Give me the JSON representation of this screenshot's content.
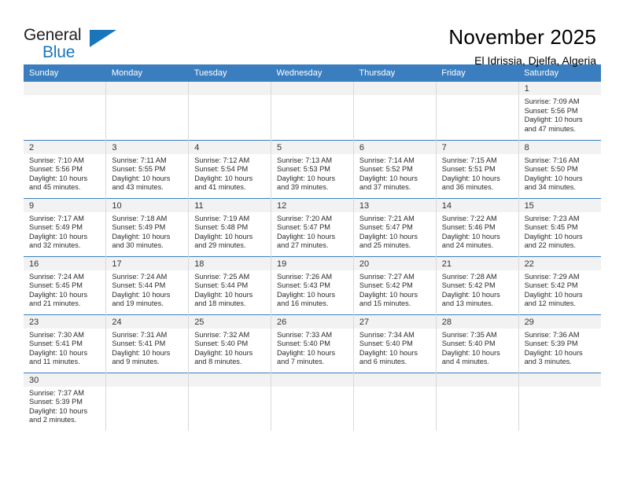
{
  "brand": {
    "line1": "General",
    "line2": "Blue",
    "triangle_color": "#1b75bb"
  },
  "header": {
    "title": "November 2025",
    "subtitle": "El Idrissia, Djelfa, Algeria"
  },
  "theme": {
    "header_blue": "#3a7ebf",
    "daynum_band": "#f2f2f2",
    "text": "#000000"
  },
  "calendar": {
    "weekday_headers": [
      "Sunday",
      "Monday",
      "Tuesday",
      "Wednesday",
      "Thursday",
      "Friday",
      "Saturday"
    ],
    "labels": {
      "sunrise": "Sunrise:",
      "sunset": "Sunset:",
      "daylight": "Daylight:"
    },
    "weeks": [
      [
        {
          "day": "",
          "blank": true
        },
        {
          "day": "",
          "blank": true
        },
        {
          "day": "",
          "blank": true
        },
        {
          "day": "",
          "blank": true
        },
        {
          "day": "",
          "blank": true
        },
        {
          "day": "",
          "blank": true
        },
        {
          "day": "1",
          "sunrise": "Sunrise: 7:09 AM",
          "sunset": "Sunset: 5:56 PM",
          "daylight": "Daylight: 10 hours and 47 minutes."
        }
      ],
      [
        {
          "day": "2",
          "sunrise": "Sunrise: 7:10 AM",
          "sunset": "Sunset: 5:56 PM",
          "daylight": "Daylight: 10 hours and 45 minutes."
        },
        {
          "day": "3",
          "sunrise": "Sunrise: 7:11 AM",
          "sunset": "Sunset: 5:55 PM",
          "daylight": "Daylight: 10 hours and 43 minutes."
        },
        {
          "day": "4",
          "sunrise": "Sunrise: 7:12 AM",
          "sunset": "Sunset: 5:54 PM",
          "daylight": "Daylight: 10 hours and 41 minutes."
        },
        {
          "day": "5",
          "sunrise": "Sunrise: 7:13 AM",
          "sunset": "Sunset: 5:53 PM",
          "daylight": "Daylight: 10 hours and 39 minutes."
        },
        {
          "day": "6",
          "sunrise": "Sunrise: 7:14 AM",
          "sunset": "Sunset: 5:52 PM",
          "daylight": "Daylight: 10 hours and 37 minutes."
        },
        {
          "day": "7",
          "sunrise": "Sunrise: 7:15 AM",
          "sunset": "Sunset: 5:51 PM",
          "daylight": "Daylight: 10 hours and 36 minutes."
        },
        {
          "day": "8",
          "sunrise": "Sunrise: 7:16 AM",
          "sunset": "Sunset: 5:50 PM",
          "daylight": "Daylight: 10 hours and 34 minutes."
        }
      ],
      [
        {
          "day": "9",
          "sunrise": "Sunrise: 7:17 AM",
          "sunset": "Sunset: 5:49 PM",
          "daylight": "Daylight: 10 hours and 32 minutes."
        },
        {
          "day": "10",
          "sunrise": "Sunrise: 7:18 AM",
          "sunset": "Sunset: 5:49 PM",
          "daylight": "Daylight: 10 hours and 30 minutes."
        },
        {
          "day": "11",
          "sunrise": "Sunrise: 7:19 AM",
          "sunset": "Sunset: 5:48 PM",
          "daylight": "Daylight: 10 hours and 29 minutes."
        },
        {
          "day": "12",
          "sunrise": "Sunrise: 7:20 AM",
          "sunset": "Sunset: 5:47 PM",
          "daylight": "Daylight: 10 hours and 27 minutes."
        },
        {
          "day": "13",
          "sunrise": "Sunrise: 7:21 AM",
          "sunset": "Sunset: 5:47 PM",
          "daylight": "Daylight: 10 hours and 25 minutes."
        },
        {
          "day": "14",
          "sunrise": "Sunrise: 7:22 AM",
          "sunset": "Sunset: 5:46 PM",
          "daylight": "Daylight: 10 hours and 24 minutes."
        },
        {
          "day": "15",
          "sunrise": "Sunrise: 7:23 AM",
          "sunset": "Sunset: 5:45 PM",
          "daylight": "Daylight: 10 hours and 22 minutes."
        }
      ],
      [
        {
          "day": "16",
          "sunrise": "Sunrise: 7:24 AM",
          "sunset": "Sunset: 5:45 PM",
          "daylight": "Daylight: 10 hours and 21 minutes."
        },
        {
          "day": "17",
          "sunrise": "Sunrise: 7:24 AM",
          "sunset": "Sunset: 5:44 PM",
          "daylight": "Daylight: 10 hours and 19 minutes."
        },
        {
          "day": "18",
          "sunrise": "Sunrise: 7:25 AM",
          "sunset": "Sunset: 5:44 PM",
          "daylight": "Daylight: 10 hours and 18 minutes."
        },
        {
          "day": "19",
          "sunrise": "Sunrise: 7:26 AM",
          "sunset": "Sunset: 5:43 PM",
          "daylight": "Daylight: 10 hours and 16 minutes."
        },
        {
          "day": "20",
          "sunrise": "Sunrise: 7:27 AM",
          "sunset": "Sunset: 5:42 PM",
          "daylight": "Daylight: 10 hours and 15 minutes."
        },
        {
          "day": "21",
          "sunrise": "Sunrise: 7:28 AM",
          "sunset": "Sunset: 5:42 PM",
          "daylight": "Daylight: 10 hours and 13 minutes."
        },
        {
          "day": "22",
          "sunrise": "Sunrise: 7:29 AM",
          "sunset": "Sunset: 5:42 PM",
          "daylight": "Daylight: 10 hours and 12 minutes."
        }
      ],
      [
        {
          "day": "23",
          "sunrise": "Sunrise: 7:30 AM",
          "sunset": "Sunset: 5:41 PM",
          "daylight": "Daylight: 10 hours and 11 minutes."
        },
        {
          "day": "24",
          "sunrise": "Sunrise: 7:31 AM",
          "sunset": "Sunset: 5:41 PM",
          "daylight": "Daylight: 10 hours and 9 minutes."
        },
        {
          "day": "25",
          "sunrise": "Sunrise: 7:32 AM",
          "sunset": "Sunset: 5:40 PM",
          "daylight": "Daylight: 10 hours and 8 minutes."
        },
        {
          "day": "26",
          "sunrise": "Sunrise: 7:33 AM",
          "sunset": "Sunset: 5:40 PM",
          "daylight": "Daylight: 10 hours and 7 minutes."
        },
        {
          "day": "27",
          "sunrise": "Sunrise: 7:34 AM",
          "sunset": "Sunset: 5:40 PM",
          "daylight": "Daylight: 10 hours and 6 minutes."
        },
        {
          "day": "28",
          "sunrise": "Sunrise: 7:35 AM",
          "sunset": "Sunset: 5:40 PM",
          "daylight": "Daylight: 10 hours and 4 minutes."
        },
        {
          "day": "29",
          "sunrise": "Sunrise: 7:36 AM",
          "sunset": "Sunset: 5:39 PM",
          "daylight": "Daylight: 10 hours and 3 minutes."
        }
      ],
      [
        {
          "day": "30",
          "sunrise": "Sunrise: 7:37 AM",
          "sunset": "Sunset: 5:39 PM",
          "daylight": "Daylight: 10 hours and 2 minutes."
        },
        {
          "day": "",
          "blank": true
        },
        {
          "day": "",
          "blank": true
        },
        {
          "day": "",
          "blank": true
        },
        {
          "day": "",
          "blank": true
        },
        {
          "day": "",
          "blank": true
        },
        {
          "day": "",
          "blank": true
        }
      ]
    ]
  }
}
